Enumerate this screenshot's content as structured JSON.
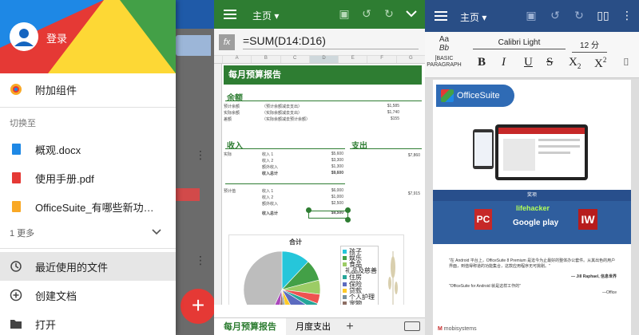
{
  "drawer": {
    "login": "登录",
    "addons": "附加组件",
    "switch_to": "切换至",
    "files": [
      {
        "name": "概观.docx",
        "color": "#1e88e5"
      },
      {
        "name": "使用手册.pdf",
        "color": "#e53935"
      },
      {
        "name": "OfficeSuite_有哪些新功能.ppt",
        "color": "#f9a825"
      }
    ],
    "more": "1 更多",
    "recent": "最近使用的文件",
    "create": "创建文档",
    "open": "打开"
  },
  "sheet": {
    "title": "主页",
    "formula": "=SUM(D14:D16)",
    "columns": [
      "A",
      "B",
      "C",
      "D",
      "E",
      "F",
      "G"
    ],
    "banner": "每月预算报告",
    "balance": "余额",
    "balance_rows": [
      [
        "预计余额",
        "（预计余额减去支出）",
        "$1,585"
      ],
      [
        "实际余额",
        "（实际余额减去支出）",
        "$1,740"
      ],
      [
        "差额",
        "（实际余额减去预计余额）",
        "$155"
      ]
    ],
    "income": "收入",
    "expense": "支出",
    "income_rows": [
      [
        "实际",
        "收入 1",
        "$5,600"
      ],
      [
        "",
        "收入 2",
        "$3,300"
      ],
      [
        "",
        "额外收入",
        "$1,300"
      ],
      [
        "",
        "收入总计",
        "$9,600"
      ]
    ],
    "income_right": "$7,860",
    "planned_rows": [
      [
        "预计值",
        "收入 1",
        "$6,000"
      ],
      [
        "",
        "收入 2",
        "$1,000"
      ],
      [
        "",
        "额外收入",
        "$2,500"
      ],
      [
        "",
        "收入总计",
        "$9,500"
      ]
    ],
    "planned_right": "$7,915",
    "chart": {
      "type": "pie",
      "title": "合计",
      "legend": [
        "孩子",
        "娱乐",
        "食品",
        "礼品及慈善",
        "住房",
        "保险",
        "贷款",
        "个人护理",
        "宠物",
        "储蓄或投资",
        "税费"
      ],
      "colors": [
        "#26c6da",
        "#43a047",
        "#9ccc65",
        "#ef5350",
        "#26a69a",
        "#5c6bc0",
        "#ffca28",
        "#78909c",
        "#8d6e63",
        "#ab47bc",
        "#bdbdbd"
      ],
      "values": [
        12,
        9,
        6,
        4,
        3,
        8,
        5,
        2,
        3,
        5,
        43
      ]
    },
    "tabs": [
      "每月预算报告",
      "月度支出"
    ]
  },
  "doc": {
    "title": "主页",
    "aa": "Aa",
    "bb": "Bb",
    "para": "[BASIC PARAGRAPH",
    "font": "Calibri Light",
    "size": "12 分",
    "bold": "B",
    "italic": "I",
    "underline": "U",
    "strike": "S",
    "sub": "X",
    "sub_mark": "2",
    "sup": "X",
    "sup_mark": "2",
    "logo": "OfficeSuite",
    "awards_head": "奖项",
    "award_pc": "PC",
    "award_lh": "lifehacker",
    "award_gp": "Google play",
    "award_iw": "IW",
    "quote1": "\"在 Android 平台上，OfficeSuite 8 Premium 是迄今为止最好的整体办公套件。从其出色的用户界面，到值得称道的功能集合，这款应用程序无可挑剔。\"",
    "quote1_by": "— Jill Raphael, 信息世界",
    "quote2": "\"OfficeSuite for Android 就是这样工作的\"",
    "quote2_by": "—Office",
    "mobi": "mobisystems"
  }
}
